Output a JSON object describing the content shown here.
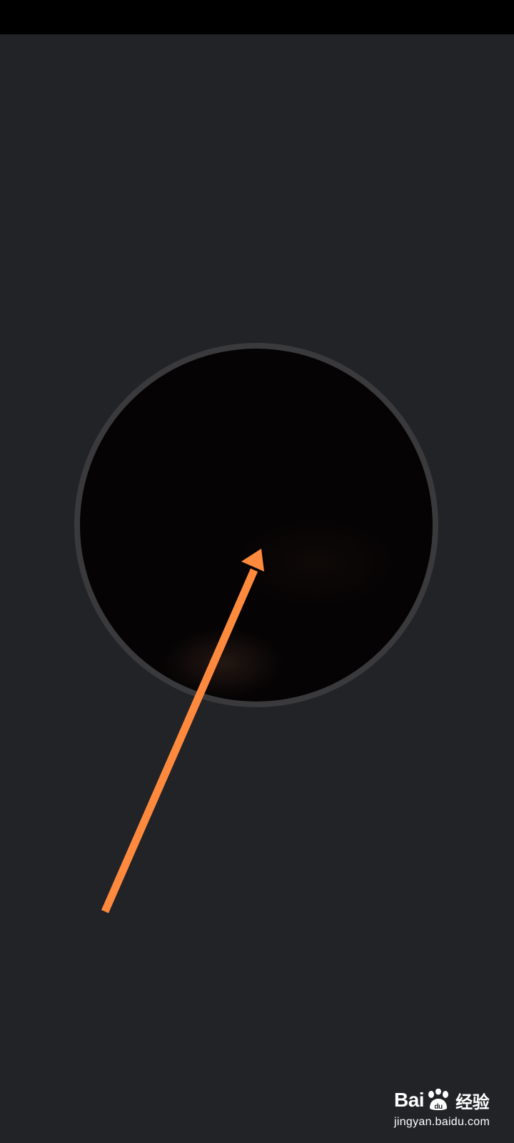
{
  "colors": {
    "background": "#212327",
    "status_bar": "#000000",
    "preview_ring": "#3a3a3c",
    "preview_fill": "#050304",
    "annotation_arrow": "#ff8a3d"
  },
  "watermark": {
    "brand_prefix": "Bai",
    "brand_suffix": "经验",
    "paw_text": "du",
    "domain": "jingyan.baidu.com"
  },
  "icons": {
    "annotation": "arrow-up-right-icon",
    "watermark": "baidu-paw-icon"
  }
}
